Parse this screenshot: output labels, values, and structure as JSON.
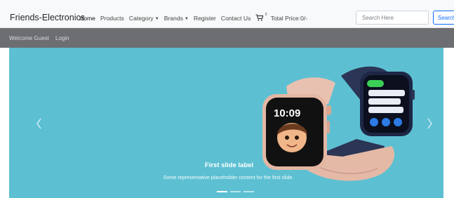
{
  "navbar": {
    "brand": "Friends-Electronics",
    "links": [
      "Home",
      "Products",
      "Category",
      "Brands",
      "Register",
      "Contact Us"
    ],
    "cart_sup": "0",
    "total_price": "Total Price:0/-",
    "search_placeholder": "Search Here",
    "search_button": "Search"
  },
  "userbar": {
    "welcome": "Welcome Guest",
    "login": "Login"
  },
  "carousel": {
    "caption_title": "First slide label",
    "caption_text": "Some representative placeholder content for the first slide.",
    "active_slide": 1,
    "slide_count": 3,
    "screen_time": "10:09"
  },
  "icons": {
    "cart": "cart-icon",
    "prev": "chevron-left-icon",
    "next": "chevron-right-icon"
  },
  "colors": {
    "navbar_bg": "#f8f9fa",
    "userbar_bg": "#6c6e72",
    "carousel_bg": "#5dc0d2",
    "primary": "#0d6efd"
  }
}
